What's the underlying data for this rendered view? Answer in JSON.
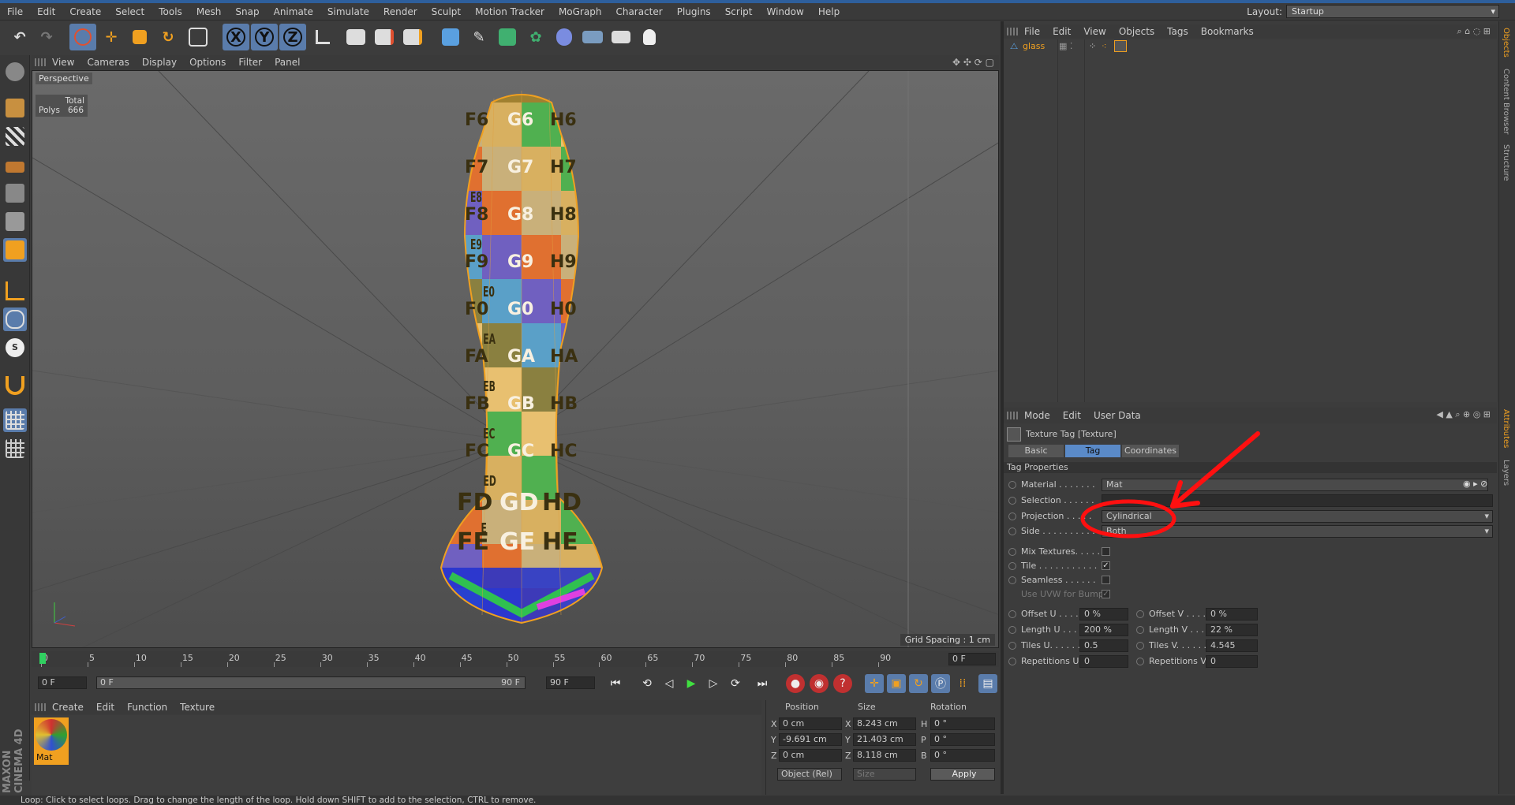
{
  "menubar": {
    "items": [
      "File",
      "Edit",
      "Create",
      "Select",
      "Tools",
      "Mesh",
      "Snap",
      "Animate",
      "Simulate",
      "Render",
      "Sculpt",
      "Motion Tracker",
      "MoGraph",
      "Character",
      "Plugins",
      "Script",
      "Window",
      "Help"
    ],
    "layout_label": "Layout:",
    "layout_value": "Startup"
  },
  "toolbar": {
    "axis_x": "X",
    "axis_y": "Y",
    "axis_z": "Z"
  },
  "viewport": {
    "menu": [
      "View",
      "Cameras",
      "Display",
      "Options",
      "Filter",
      "Panel"
    ],
    "title": "Perspective",
    "stats_total_label": "Total",
    "stats_polys_label": "Polys",
    "stats_polys_value": "666",
    "grid_spacing": "Grid Spacing : 1 cm",
    "texture_labels": [
      "F6",
      "G6",
      "H6",
      "F7",
      "G7",
      "H7",
      "F8",
      "G8",
      "H8",
      "F9",
      "G9",
      "H9",
      "F0",
      "G0",
      "H0",
      "FA",
      "GA",
      "HA",
      "FB",
      "GB",
      "HB",
      "FC",
      "GC",
      "HC",
      "FD",
      "GD",
      "HD",
      "FE",
      "GE",
      "HE"
    ],
    "side_labels": [
      "E8",
      "E9",
      "E0",
      "EA",
      "EB",
      "EC",
      "ED",
      "E"
    ]
  },
  "timeline": {
    "ticks": [
      "0",
      "5",
      "10",
      "15",
      "20",
      "25",
      "30",
      "35",
      "40",
      "45",
      "50",
      "55",
      "60",
      "65",
      "70",
      "75",
      "80",
      "85",
      "90"
    ],
    "current_frame": "0 F"
  },
  "transport": {
    "start_field": "0 F",
    "range_start": "0 F",
    "range_end": "90 F",
    "end_field": "90 F"
  },
  "material_manager": {
    "menu": [
      "Create",
      "Edit",
      "Function",
      "Texture"
    ],
    "material_name": "Mat"
  },
  "coordinates": {
    "col_position": "Position",
    "col_size": "Size",
    "col_rotation": "Rotation",
    "pos_x": "0 cm",
    "pos_y": "-9.691 cm",
    "pos_z": "0 cm",
    "size_x": "8.243 cm",
    "size_y": "21.403 cm",
    "size_z": "8.118 cm",
    "rot_h": "0 °",
    "rot_p": "0 °",
    "rot_b": "0 °",
    "label_x": "X",
    "label_y": "Y",
    "label_z": "Z",
    "label_h": "H",
    "label_p": "P",
    "label_b": "B",
    "mode_select": "Object (Rel)",
    "size_select": "Size",
    "apply": "Apply"
  },
  "object_manager": {
    "menu": [
      "File",
      "Edit",
      "View",
      "Objects",
      "Tags",
      "Bookmarks"
    ],
    "object_name": "glass"
  },
  "attributes": {
    "menu": [
      "Mode",
      "Edit",
      "User Data"
    ],
    "header": "Texture Tag [Texture]",
    "tabs": [
      "Basic",
      "Tag",
      "Coordinates"
    ],
    "section": "Tag Properties",
    "material_label": "Material . . . . . . .",
    "material_value": "Mat",
    "selection_label": "Selection . . . . . .",
    "projection_label": "Projection . . . . .",
    "projection_value": "Cylindrical",
    "side_label": "Side . . . . . . . . . .",
    "side_value": "Both",
    "mix_label": "Mix Textures. . . . .",
    "tile_label": "Tile . . . . . . . . . . .",
    "seamless_label": "Seamless . . . . . .",
    "uvw_label": "Use UVW for Bump",
    "offset_u_label": "Offset U . . . .",
    "offset_u": "0 %",
    "offset_v_label": "Offset V . . . .",
    "offset_v": "0 %",
    "length_u_label": "Length U . . . .",
    "length_u": "200 %",
    "length_v_label": "Length V . . . .",
    "length_v": "22 %",
    "tiles_u_label": "Tiles U. . . . . .",
    "tiles_u": "0.5",
    "tiles_v_label": "Tiles V. . . . . .",
    "tiles_v": "4.545",
    "rep_u_label": "Repetitions U",
    "rep_u": "0",
    "rep_v_label": "Repetitions V",
    "rep_v": "0"
  },
  "right_tabs": [
    "Objects",
    "Content Browser",
    "Structure",
    "Attributes",
    "Layers"
  ],
  "status": "Loop: Click to select loops. Drag to change the length of the loop. Hold down SHIFT to add to the selection, CTRL to remove.",
  "branding": "MAXON CINEMA 4D"
}
